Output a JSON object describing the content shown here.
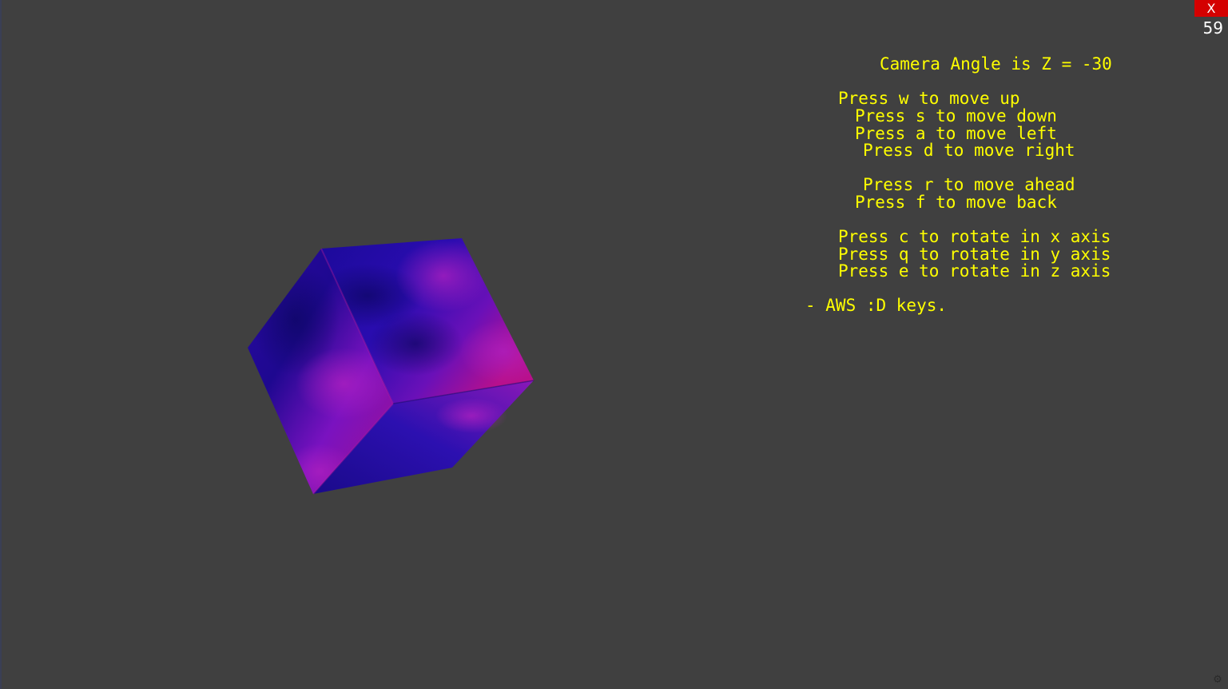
{
  "window": {
    "close_label": "X",
    "fps": "59"
  },
  "hud": {
    "camera_angle": "Camera Angle is Z = -30",
    "move_up": "Press w to move up",
    "move_down": "Press s to move down",
    "move_left": "Press a to move left",
    "move_right": "Press d to move right",
    "move_ahead": "Press r to move ahead",
    "move_back": "Press f to move back",
    "rotate_x": "Press c to rotate in x axis",
    "rotate_y": "Press q to rotate in y axis",
    "rotate_z": "Press e to rotate in z axis",
    "keys_note": "- AWS :D keys."
  },
  "colors": {
    "background": "#404040",
    "hud_text": "#ffff00",
    "close_button": "#d40000",
    "cube_blue": "#2a10a0",
    "cube_purple": "#8a10c8",
    "cube_magenta": "#b0108a"
  },
  "icons": {
    "settings": "gear-icon"
  }
}
